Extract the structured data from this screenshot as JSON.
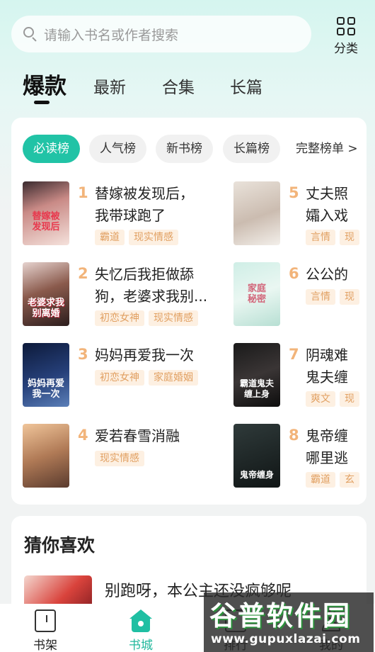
{
  "search": {
    "placeholder": "请输入书名或作者搜索"
  },
  "category": {
    "label": "分类"
  },
  "top_tabs": [
    "爆款",
    "最新",
    "合集",
    "长篇"
  ],
  "rank_chips": [
    "必读榜",
    "人气榜",
    "新书榜",
    "长篇榜",
    "完整榜单 >"
  ],
  "books": [
    {
      "rank": "1",
      "title_lines": [
        "替嫁被发现后，",
        "我带球跑了"
      ],
      "tags": [
        "霸道",
        "现实情感"
      ],
      "cover_text": "替嫁被\n发现后"
    },
    {
      "rank": "2",
      "title_lines": [
        "失忆后我拒做舔",
        "狗，老婆求我别..."
      ],
      "tags": [
        "初恋女神",
        "现实情感"
      ],
      "cover_text": "老婆求我\n别离婚"
    },
    {
      "rank": "3",
      "title_lines": [
        "妈妈再爱我一次"
      ],
      "tags": [
        "初恋女神",
        "家庭婚姻"
      ],
      "cover_text": "妈妈再爱\n我一次"
    },
    {
      "rank": "4",
      "title_lines": [
        "爱若春雪消融"
      ],
      "tags": [
        "现实情感"
      ],
      "cover_text": ""
    },
    {
      "rank": "5",
      "title_lines": [
        "丈夫照",
        "孀入戏"
      ],
      "tags": [
        "言情",
        "现"
      ],
      "cover_text": ""
    },
    {
      "rank": "6",
      "title_lines": [
        "公公的"
      ],
      "tags": [
        "言情",
        "现"
      ],
      "cover_text": "家庭\n秘密"
    },
    {
      "rank": "7",
      "title_lines": [
        "阴魂难",
        "鬼夫缠"
      ],
      "tags": [
        "爽文",
        "现"
      ],
      "cover_text": "霸道鬼夫\n缠上身"
    },
    {
      "rank": "8",
      "title_lines": [
        "鬼帝缠",
        "哪里逃"
      ],
      "tags": [
        "霸道",
        "玄"
      ],
      "cover_text": "鬼帝缠身"
    }
  ],
  "guess": {
    "title": "猜你喜欢",
    "book_title": "别跑呀，本公主还没疯够呢"
  },
  "bottom_nav": [
    "书架",
    "书城",
    "排行",
    "我的"
  ],
  "watermark": {
    "title": "谷普软件园",
    "url": "www.gupuxlazai.com"
  },
  "colors": {
    "accent": "#21c3a6",
    "tag_text": "#e1a062",
    "tag_bg": "#fdf0e2",
    "rank_num": "#f2b47a"
  }
}
